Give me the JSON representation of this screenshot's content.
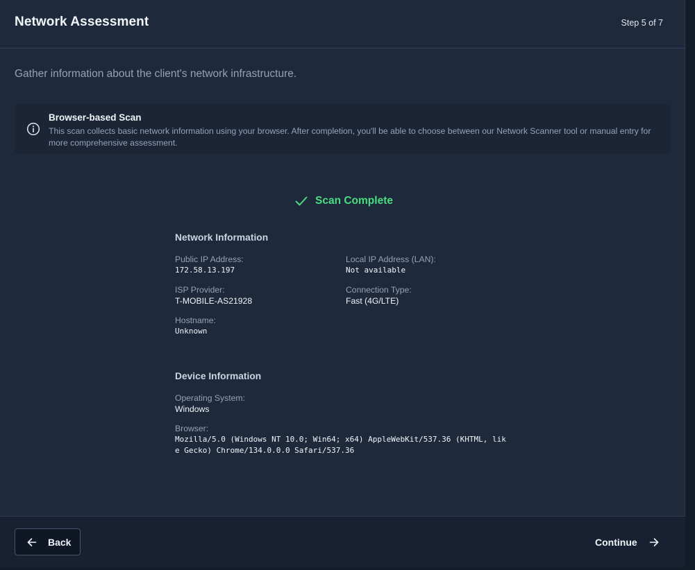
{
  "header": {
    "title": "Network Assessment",
    "step": "Step 5 of 7"
  },
  "subtitle": "Gather information about the client's network infrastructure.",
  "info": {
    "title": "Browser-based Scan",
    "text": "This scan collects basic network information using your browser. After completion, you'll be able to choose between our Network Scanner tool or manual entry for more comprehensive assessment.",
    "icon": "info-circle-icon"
  },
  "scan": {
    "status": "Scan Complete",
    "icon": "check-icon",
    "color": "#4ade80"
  },
  "network": {
    "title": "Network Information",
    "public_ip_label": "Public IP Address:",
    "public_ip_value": "172.58.13.197",
    "local_ip_label": "Local IP Address (LAN):",
    "local_ip_value": "Not available",
    "isp_label": "ISP Provider:",
    "isp_value": "T-MOBILE-AS21928",
    "connection_label": "Connection Type:",
    "connection_value": "Fast (4G/LTE)",
    "hostname_label": "Hostname:",
    "hostname_value": "Unknown"
  },
  "device": {
    "title": "Device Information",
    "os_label": "Operating System:",
    "os_value": "Windows",
    "browser_label": "Browser:",
    "browser_value": "Mozilla/5.0 (Windows NT 10.0; Win64; x64) AppleWebKit/537.36 (KHTML, like Gecko) Chrome/134.0.0.0 Safari/537.36"
  },
  "footer": {
    "back_label": "Back",
    "back_icon": "arrow-left-icon",
    "continue_label": "Continue",
    "continue_icon": "arrow-right-icon"
  },
  "colors": {
    "background": "#1e293b",
    "accent_success": "#4ade80",
    "text_primary": "#f1f5f9",
    "text_muted": "#94a3b8"
  }
}
